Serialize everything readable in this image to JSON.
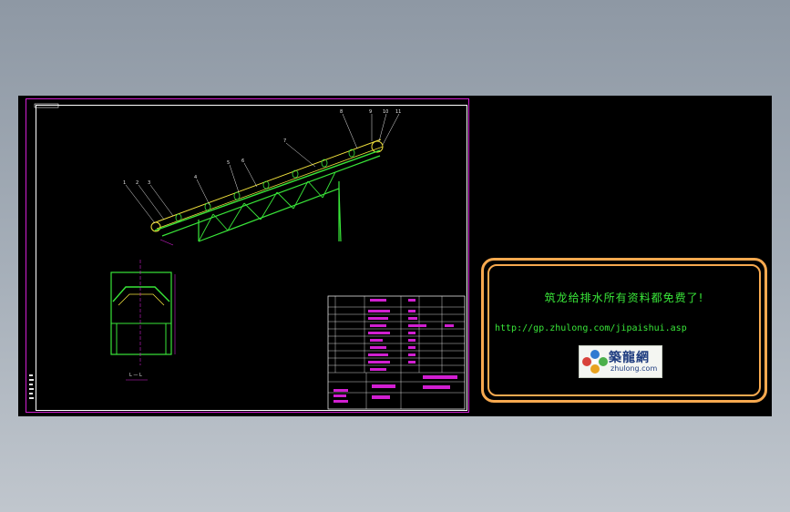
{
  "notice": {
    "title": "筑龙给排水所有资料都免费了!",
    "url": "http://gp.zhulong.com/jipaishui.asp"
  },
  "logo": {
    "chinese": "築龍網",
    "english": "zhulong.com"
  },
  "drawing": {
    "section_label": "L — L",
    "callouts": [
      "1",
      "2",
      "3",
      "4",
      "5",
      "6",
      "7",
      "8",
      "9",
      "10",
      "11"
    ]
  },
  "colors": {
    "desktop_top": "#8e98a4",
    "canvas": "#000000",
    "frame": "#d11fd1",
    "structure": "#39e639",
    "belt": "#f2e23c",
    "notice_border": "#f7a94f"
  }
}
